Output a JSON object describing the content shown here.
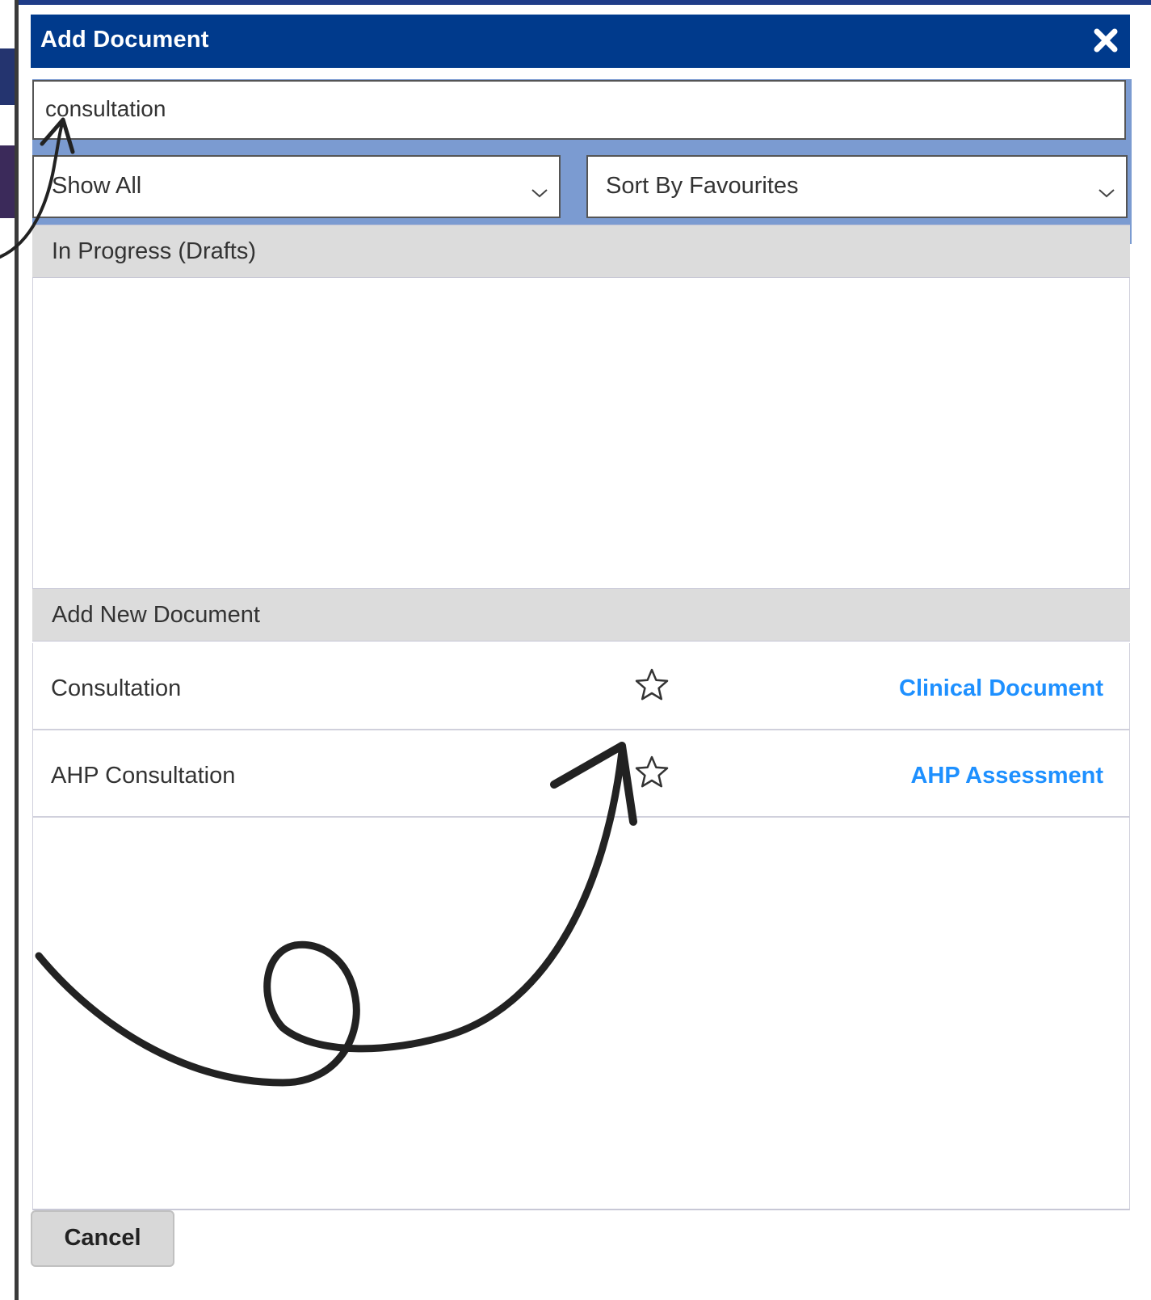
{
  "dialog": {
    "title": "Add Document",
    "close_icon": "close-icon"
  },
  "search": {
    "value": "consultation"
  },
  "filters": {
    "show": {
      "selected": "Show All",
      "icon": "chevron-down-icon"
    },
    "sort": {
      "selected": "Sort By Favourites",
      "icon": "chevron-down-icon"
    }
  },
  "sections": {
    "drafts": {
      "label": "In Progress (Drafts)"
    },
    "new_document": {
      "label": "Add New Document"
    }
  },
  "documents": [
    {
      "name": "Consultation",
      "type": "Clinical Document",
      "favourite_icon": "star-outline-icon"
    },
    {
      "name": "AHP Consultation",
      "type": "AHP Assessment",
      "favourite_icon": "star-outline-icon"
    }
  ],
  "footer": {
    "cancel_label": "Cancel"
  },
  "colors": {
    "titlebar": "#003a8c",
    "filter_band": "#7b9bd1",
    "link": "#1e90ff",
    "section_header": "#dcdcdc"
  },
  "annotations": {
    "arrow_icon": "hand-drawn-arrow"
  }
}
